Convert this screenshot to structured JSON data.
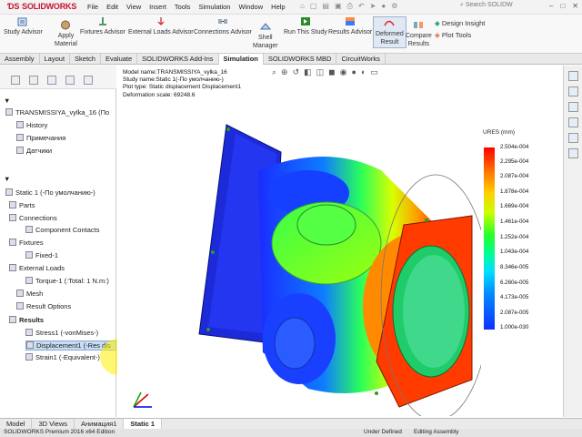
{
  "app": {
    "logo": "SOLIDWORKS",
    "menus": [
      "File",
      "Edit",
      "View",
      "Insert",
      "Tools",
      "Simulation",
      "Window",
      "Help"
    ],
    "search_placeholder": "Search SOLIDW"
  },
  "ribbon": {
    "buttons": [
      {
        "label": "Study Advisor",
        "selected": false
      },
      {
        "label": "Apply\nMaterial",
        "selected": false
      },
      {
        "label": "Fixtures Advisor",
        "selected": false
      },
      {
        "label": "External Loads Advisor",
        "selected": false
      },
      {
        "label": "Connections Advisor",
        "selected": false
      },
      {
        "label": "Shell\nManager",
        "selected": false
      },
      {
        "label": "Run This Study",
        "selected": false
      },
      {
        "label": "Results Advisor",
        "selected": false
      },
      {
        "label": "Deformed\nResult",
        "selected": true
      },
      {
        "label": "Compare\nResults",
        "selected": false
      }
    ],
    "side": [
      "Design Insight",
      "Plot Tools"
    ]
  },
  "tabs": [
    {
      "label": "Assembly",
      "active": false
    },
    {
      "label": "Layout",
      "active": false
    },
    {
      "label": "Sketch",
      "active": false
    },
    {
      "label": "Evaluate",
      "active": false
    },
    {
      "label": "SOLIDWORKS Add-Ins",
      "active": false
    },
    {
      "label": "Simulation",
      "active": true
    },
    {
      "label": "SOLIDWORKS MBD",
      "active": false
    },
    {
      "label": "CircuitWorks",
      "active": false
    }
  ],
  "tree": {
    "top": [
      {
        "label": "TRANSMISSIYA_vylka_16  (По"
      },
      {
        "label": "History"
      },
      {
        "label": "Примечания"
      },
      {
        "label": "Датчики"
      }
    ],
    "study": [
      {
        "label": "Static 1 (-По умолчанию-)",
        "indent": 0
      },
      {
        "label": "Parts",
        "indent": 1
      },
      {
        "label": "Connections",
        "indent": 1
      },
      {
        "label": "Component Contacts",
        "indent": 2
      },
      {
        "label": "Fixtures",
        "indent": 1
      },
      {
        "label": "Fixed-1",
        "indent": 2
      },
      {
        "label": "External Loads",
        "indent": 1
      },
      {
        "label": "Torque-1 (:Total: 1 N.m:)",
        "indent": 2
      },
      {
        "label": "Mesh",
        "indent": 1
      },
      {
        "label": "Result Options",
        "indent": 1
      },
      {
        "label": "Results",
        "indent": 1
      },
      {
        "label": "Stress1 (-vonMises-)",
        "indent": 2
      },
      {
        "label": "Displacement1 (-Res dis",
        "indent": 2,
        "highlight": true
      },
      {
        "label": "Strain1 (-Equivalent-)",
        "indent": 2
      }
    ]
  },
  "info": [
    "Model name:TRANSMISSIYA_vylka_16",
    "Study name:Static 1(-По умолчанию-)",
    "Plot type: Static displacement Displacement1",
    "Deformation scale: 69248.6"
  ],
  "legend": {
    "title": "URES (mm)",
    "values": [
      "2.504e-004",
      "2.295e-004",
      "2.087e-004",
      "1.878e-004",
      "1.669e-004",
      "1.461e-004",
      "1.252e-004",
      "1.043e-004",
      "8.346e-005",
      "6.260e-005",
      "4.173e-005",
      "2.087e-005",
      "1.000e-030"
    ]
  },
  "bottom_tabs": [
    {
      "label": "Model",
      "active": false
    },
    {
      "label": "3D Views",
      "active": false
    },
    {
      "label": "Анимация1",
      "active": false
    },
    {
      "label": "Static 1",
      "active": true
    }
  ],
  "status": {
    "left": "SOLIDWORKS Premium 2016 x64 Edition",
    "mid": "Under Defined",
    "right": "Editing Assembly"
  }
}
